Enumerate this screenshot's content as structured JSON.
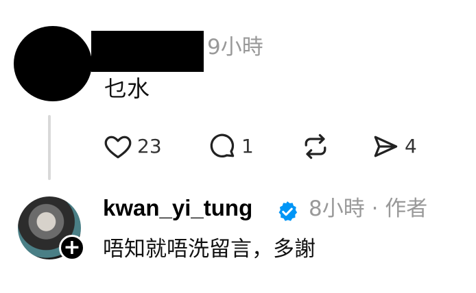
{
  "comment1": {
    "time": "9小時",
    "text": "乜水",
    "likes": "23",
    "replies": "1",
    "shares": "4"
  },
  "comment2": {
    "username": "kwan_yi_tung",
    "time_author": "8小時 · 作者",
    "text": "唔知就唔洗留言，多謝"
  },
  "colors": {
    "secondary_text": "#999999",
    "verified_blue": "#0095f6",
    "thread_line": "#d9d9d9"
  },
  "icons": [
    "heart-icon",
    "comment-icon",
    "repost-icon",
    "send-icon",
    "verified-icon",
    "plus-icon"
  ]
}
